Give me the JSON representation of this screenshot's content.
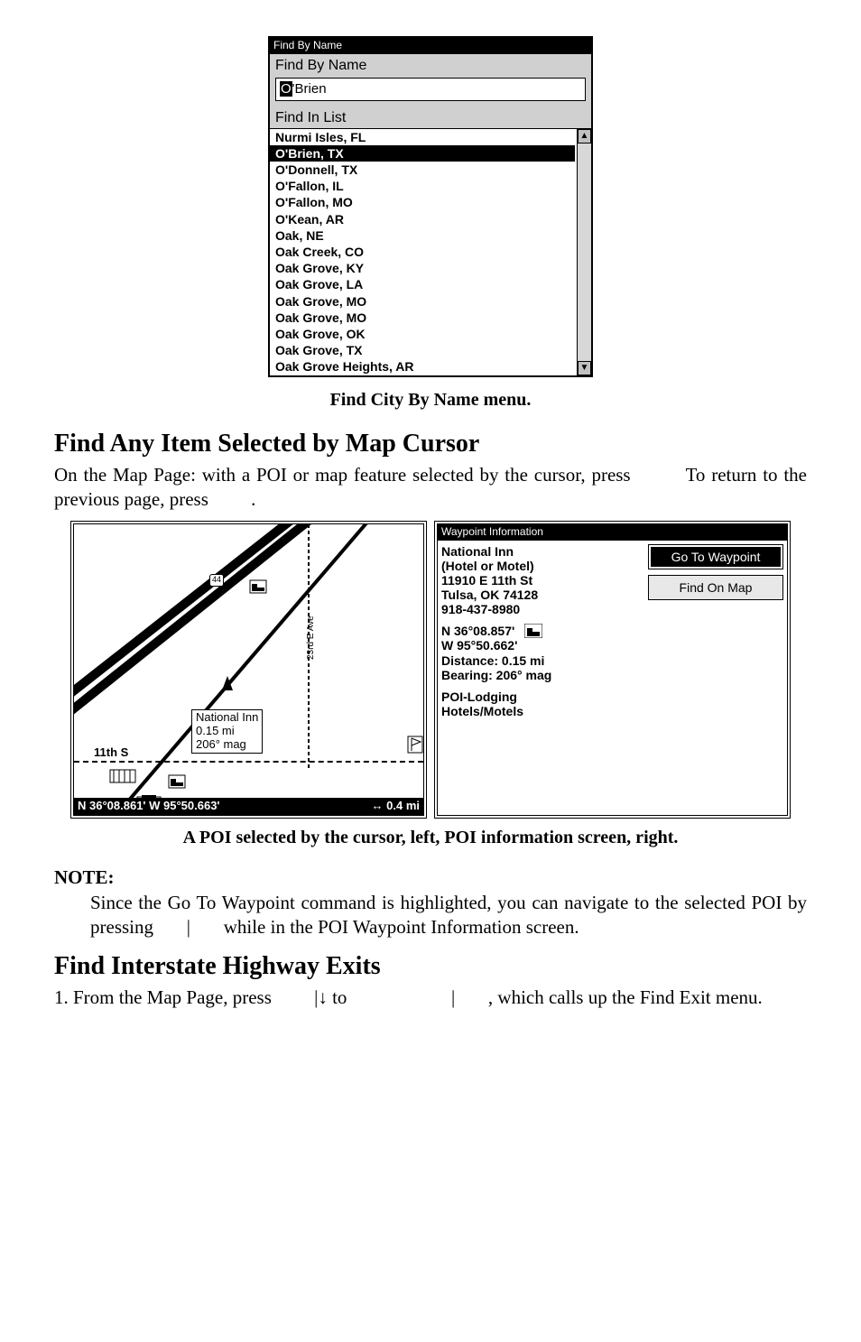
{
  "find_by_name": {
    "window_title": "Find By Name",
    "label": "Find By Name",
    "input_cursor": "O",
    "input_rest": "'Brien",
    "list_label": "Find In List",
    "items": [
      "Nurmi Isles, FL",
      "O'Brien, TX",
      "O'Donnell, TX",
      "O'Fallon, IL",
      "O'Fallon, MO",
      "O'Kean, AR",
      "Oak, NE",
      "Oak Creek, CO",
      "Oak Grove, KY",
      "Oak Grove, LA",
      "Oak Grove, MO",
      "Oak Grove, MO",
      "Oak Grove, OK",
      "Oak Grove, TX",
      "Oak Grove Heights, AR"
    ],
    "selected_index": 1
  },
  "captions": {
    "fbn": "Find City By Name menu.",
    "poi": "A POI selected by the cursor, left, POI information screen, right."
  },
  "sections": {
    "find_any_title": "Find Any Item Selected by Map Cursor",
    "find_any_body1": "On the Map Page: with a POI or map feature selected by the cursor, press",
    "find_any_body2": "To return to the previous page, press",
    "find_any_body2_end": ".",
    "find_interstate_title": "Find Interstate Highway Exits",
    "find_interstate_line1a": "1. From the Map Page, press",
    "find_interstate_line1b": "|↓ to",
    "find_interstate_line1c": "|",
    "find_interstate_line1d": ", which calls up the Find Exit menu."
  },
  "map_panel": {
    "label_name": "National Inn",
    "label_dist": "0.15 mi",
    "label_bearing": "206° mag",
    "street": "11th S",
    "road_labels": {
      "ave": "23rd E Ave"
    },
    "shield1": "44",
    "coord_bar_left": "N   36°08.861'    W    95°50.663'",
    "coord_bar_right": "↔   0.4 mi"
  },
  "wp_panel": {
    "title": "Waypoint Information",
    "lines": [
      "National Inn",
      "(Hotel or Motel)",
      "11910 E 11th St",
      "Tulsa, OK 74128",
      "918-437-8980"
    ],
    "coords": [
      "N    36°08.857'",
      "W    95°50.662'"
    ],
    "dist": "Distance:    0.15 mi",
    "bearing": "Bearing:     206° mag",
    "cat1": "POI-Lodging",
    "cat2": "Hotels/Motels",
    "btn_goto": "Go To Waypoint",
    "btn_find": "Find On Map"
  },
  "note": {
    "heading": "NOTE:",
    "body1": "Since the Go To Waypoint command is highlighted, you can navigate to the selected POI by pressing",
    "body_sep": "|",
    "body2": "while in the POI Waypoint Information screen."
  }
}
